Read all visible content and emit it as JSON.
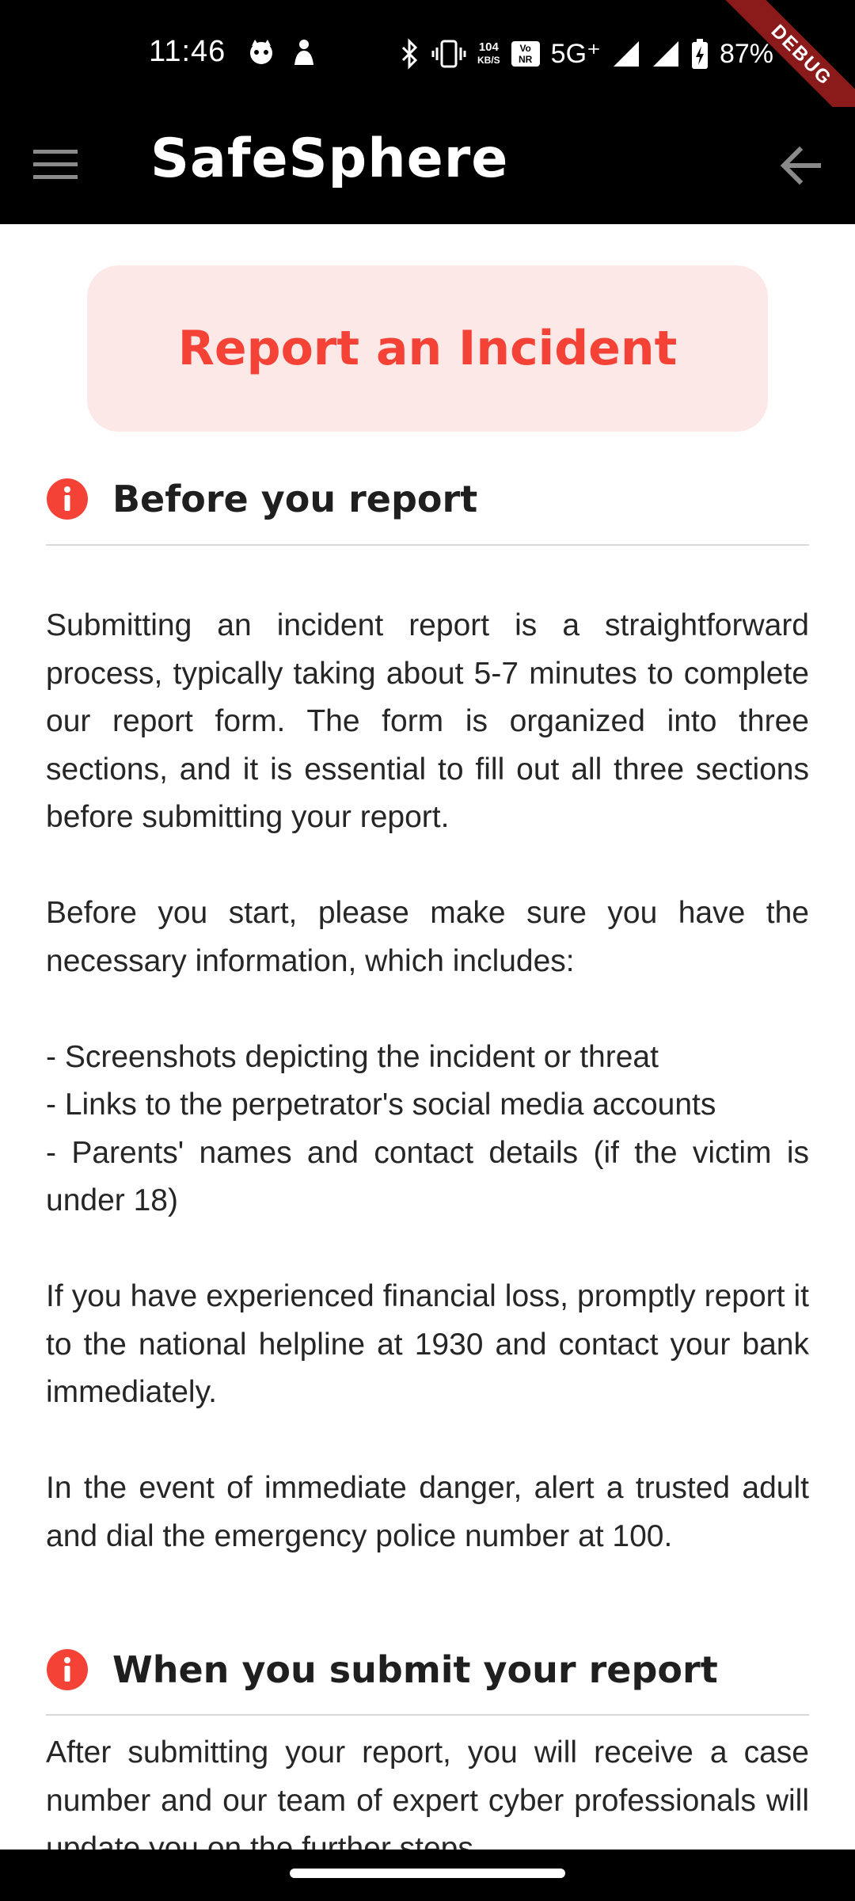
{
  "status_bar": {
    "time": "11:46",
    "network_speed_value": "104",
    "network_speed_unit": "KB/S",
    "volte_top": "Vo",
    "volte_bottom": "NR",
    "network_type": "5G⁺",
    "battery": "87%",
    "debug_label": "DEBUG",
    "icons": [
      "cat-face-icon",
      "person-icon",
      "bluetooth-icon",
      "vibrate-icon",
      "signal-icon",
      "signal-icon",
      "battery-charging-icon"
    ]
  },
  "app_bar": {
    "title": "SafeSphere",
    "menu_icon": "menu-icon",
    "back_icon": "back-arrow-icon"
  },
  "banner": {
    "title": "Report an Incident"
  },
  "colors": {
    "accent_red": "#f44336",
    "banner_bg": "#fde8e8",
    "text_dark": "#262626",
    "divider": "#d9d9d9"
  },
  "sections": [
    {
      "title": "Before you report",
      "icon": "info-icon",
      "paragraphs": [
        "Submitting an incident report is a straightforward process, typically taking about 5-7 minutes to complete our report form. The form is organized into three sections, and it is essential to fill out all three sections before submitting your report.",
        "Before you start, please make sure you have the necessary information, which includes:",
        "If you have experienced financial loss, promptly report it to the national helpline at 1930 and contact your bank immediately.",
        "In the event of immediate danger, alert a trusted adult and dial the emergency police number at 100."
      ],
      "list": [
        "- Screenshots depicting the incident or threat",
        "- Links to the perpetrator's social media accounts",
        "- Parents' names and contact details (if the victim is under 18)"
      ]
    },
    {
      "title": "When you submit your report",
      "icon": "info-icon",
      "paragraphs": [
        "After submitting your report, you will receive a case number and our team of expert cyber professionals will update you on the further steps."
      ]
    }
  ]
}
